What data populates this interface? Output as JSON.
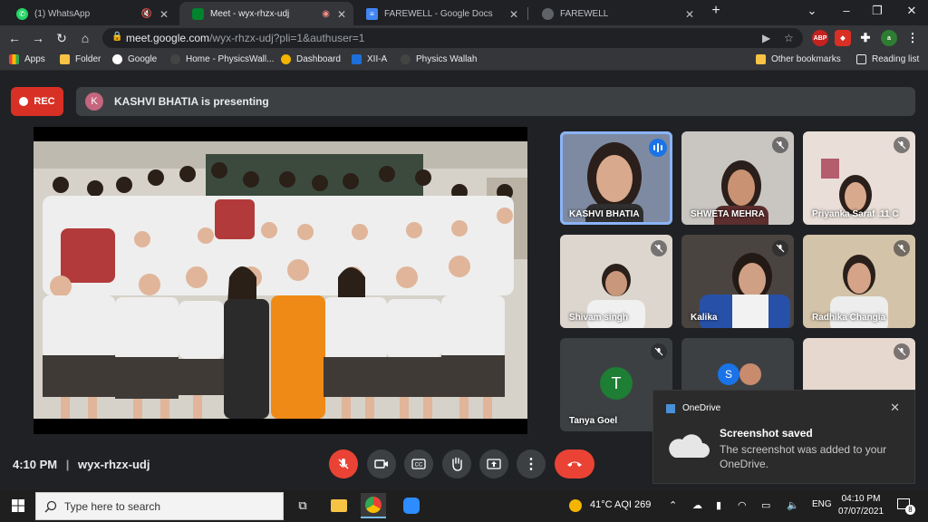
{
  "browser": {
    "tabs": [
      {
        "label": "(1) WhatsApp",
        "favicon": "whatsapp-icon",
        "active": false
      },
      {
        "label": "Meet - wyx-rhzx-udj",
        "favicon": "meet-icon",
        "active": true
      },
      {
        "label": "FAREWELL - Google Docs",
        "favicon": "docs-icon",
        "active": false
      },
      {
        "label": "FAREWELL",
        "favicon": "globe-icon",
        "active": false
      }
    ],
    "url_host": "meet.google.com",
    "url_path": "/wyx-rhzx-udj?pli=1&authuser=1",
    "profile_initial": "a",
    "bookmarks": [
      {
        "label": "Apps"
      },
      {
        "label": "Folder"
      },
      {
        "label": "Google"
      },
      {
        "label": "Home - PhysicsWall..."
      },
      {
        "label": "Dashboard"
      },
      {
        "label": "XII-A"
      },
      {
        "label": "Physics Wallah"
      }
    ],
    "other_bookmarks": "Other bookmarks",
    "reading_list": "Reading list"
  },
  "meet": {
    "rec_label": "REC",
    "presenter_initial": "K",
    "presenting_text": "KASHVI BHATIA is presenting",
    "time": "4:10 PM",
    "separator": "|",
    "meeting_code": "wyx-rhzx-udj",
    "participants": [
      {
        "name": "KASHVI BHATIA",
        "muted": false,
        "speaking": true
      },
      {
        "name": "SHWETA MEHRA",
        "muted": true
      },
      {
        "name": "Priyanka Saraf .11 C",
        "muted": true
      },
      {
        "name": "Shivam singh",
        "muted": true
      },
      {
        "name": "Kalika",
        "muted": true
      },
      {
        "name": "Radhika Changia",
        "muted": true
      },
      {
        "name": "Tanya Goel",
        "muted": true,
        "initial": "T"
      },
      {
        "name": "",
        "muted": false,
        "initial": "S"
      },
      {
        "name": "",
        "muted": true
      }
    ]
  },
  "toast": {
    "app": "OneDrive",
    "title": "Screenshot saved",
    "body": "The screenshot was added to your OneDrive."
  },
  "taskbar": {
    "search_placeholder": "Type here to search",
    "weather": "41°C  AQI 269",
    "language": "ENG",
    "time": "04:10 PM",
    "date": "07/07/2021",
    "notifications": "8"
  }
}
